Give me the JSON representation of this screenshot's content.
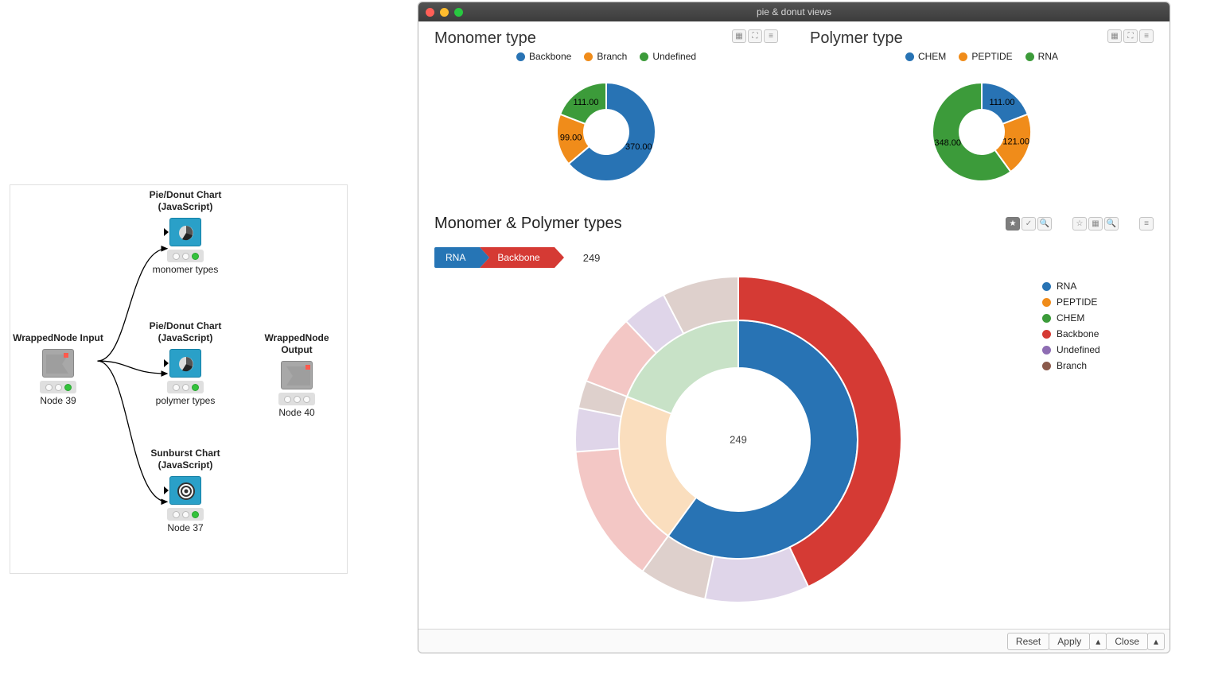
{
  "workflow": {
    "nodes": {
      "input": {
        "title": "WrappedNode Input",
        "caption": "Node 39"
      },
      "chart1": {
        "title": "Pie/Donut Chart\n(JavaScript)",
        "caption": "monomer types"
      },
      "chart2": {
        "title": "Pie/Donut Chart\n(JavaScript)",
        "caption": "polymer types"
      },
      "sunburst": {
        "title": "Sunburst Chart\n(JavaScript)",
        "caption": "Node 37"
      },
      "output": {
        "title": "WrappedNode Output",
        "caption": "Node 40"
      }
    }
  },
  "window": {
    "title": "pie & donut views",
    "charts": {
      "monomer": {
        "title": "Monomer type",
        "legend": [
          {
            "label": "Backbone",
            "color": "#2873b4"
          },
          {
            "label": "Branch",
            "color": "#f08c1a"
          },
          {
            "label": "Undefined",
            "color": "#3c9b3a"
          }
        ]
      },
      "polymer": {
        "title": "Polymer type",
        "legend": [
          {
            "label": "CHEM",
            "color": "#2873b4"
          },
          {
            "label": "PEPTIDE",
            "color": "#f08c1a"
          },
          {
            "label": "RNA",
            "color": "#3c9b3a"
          }
        ]
      }
    },
    "sunburst": {
      "title": "Monomer & Polymer types",
      "breadcrumb": {
        "level1": "RNA",
        "level2": "Backbone",
        "value": "249"
      },
      "center_value": "249",
      "legend": [
        {
          "label": "RNA",
          "color": "#2873b4"
        },
        {
          "label": "PEPTIDE",
          "color": "#f08c1a"
        },
        {
          "label": "CHEM",
          "color": "#3c9b3a"
        },
        {
          "label": "Backbone",
          "color": "#d53a34"
        },
        {
          "label": "Undefined",
          "color": "#8e6db3"
        },
        {
          "label": "Branch",
          "color": "#8b5a4c"
        }
      ]
    },
    "footer": {
      "reset": "Reset",
      "apply": "Apply",
      "close": "Close"
    }
  },
  "chart_data": [
    {
      "type": "pie",
      "title": "Monomer type",
      "series": [
        {
          "name": "Backbone",
          "value": 370.0,
          "color": "#2873b4"
        },
        {
          "name": "Branch",
          "value": 99.0,
          "color": "#f08c1a"
        },
        {
          "name": "Undefined",
          "value": 111.0,
          "color": "#3c9b3a"
        }
      ],
      "donut": true
    },
    {
      "type": "pie",
      "title": "Polymer type",
      "series": [
        {
          "name": "CHEM",
          "value": 111.0,
          "color": "#2873b4"
        },
        {
          "name": "PEPTIDE",
          "value": 121.0,
          "color": "#f08c1a"
        },
        {
          "name": "RNA",
          "value": 348.0,
          "color": "#3c9b3a"
        }
      ],
      "donut": true
    },
    {
      "type": "pie",
      "title": "Monomer & Polymer types (sunburst)",
      "inner_ring_categories": [
        "RNA",
        "PEPTIDE",
        "CHEM"
      ],
      "outer_ring_categories": [
        "Backbone",
        "Undefined",
        "Branch"
      ],
      "selected_path": [
        "RNA",
        "Backbone"
      ],
      "selected_value": 249,
      "series": [
        {
          "name": "RNA",
          "value": 348,
          "color": "#2873b4"
        },
        {
          "name": "PEPTIDE",
          "value": 121,
          "color": "#f08c1a"
        },
        {
          "name": "CHEM",
          "value": 111,
          "color": "#3c9b3a"
        },
        {
          "name": "Backbone",
          "value": 370,
          "color": "#d53a34"
        },
        {
          "name": "Undefined",
          "value": 111,
          "color": "#8e6db3"
        },
        {
          "name": "Branch",
          "value": 99,
          "color": "#8b5a4c"
        }
      ]
    }
  ]
}
